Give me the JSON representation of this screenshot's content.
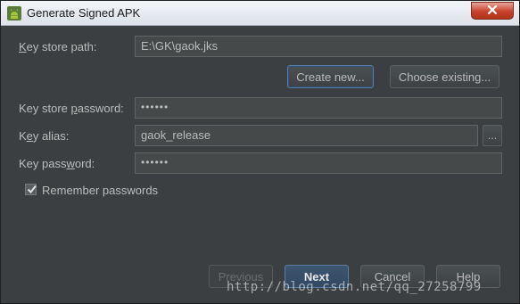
{
  "window": {
    "title": "Generate Signed APK",
    "close_icon": "close-icon",
    "app_icon": "android-icon"
  },
  "form": {
    "key_store_path": {
      "label_pre": "",
      "label_ul": "K",
      "label_post": "ey store path:",
      "value": "E:\\GK\\gaok.jks"
    },
    "key_store_password": {
      "label_pre": "Key store ",
      "label_ul": "p",
      "label_post": "assword:",
      "value": "••••••"
    },
    "key_alias": {
      "label_pre": "K",
      "label_ul": "e",
      "label_post": "y alias:",
      "value": "gaok_release"
    },
    "key_password": {
      "label_pre": "Key pass",
      "label_ul": "w",
      "label_post": "ord:",
      "value": "••••••"
    }
  },
  "keystore_buttons": {
    "create_new": "Create new...",
    "choose_existing": "Choose existing..."
  },
  "browse_button": "...",
  "remember": {
    "label": "Remember passwords",
    "checked": true
  },
  "footer": {
    "previous": "Previous",
    "next": "Next",
    "cancel": "Cancel",
    "help": "Help"
  },
  "watermark": "http://blog.csdn.net/qq_27258799",
  "colors": {
    "background": "#3c3f41",
    "field": "#45494a",
    "accent": "#5a7da3",
    "close": "#c7412b"
  }
}
